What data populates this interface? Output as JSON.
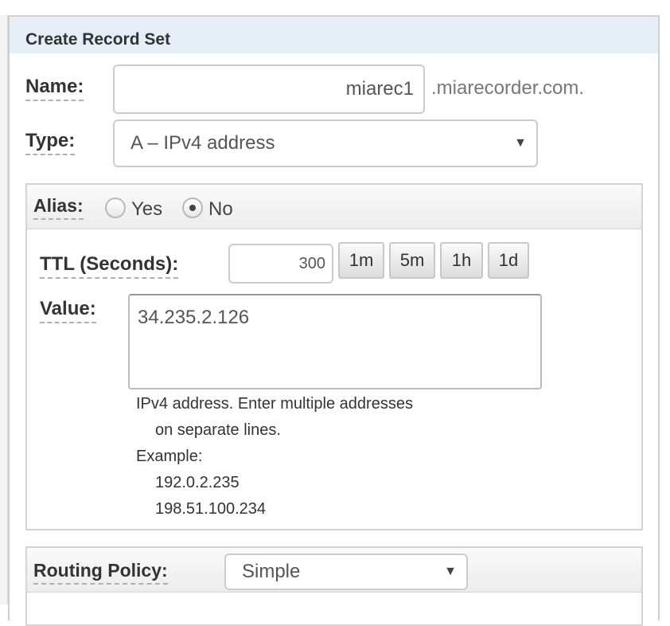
{
  "panel": {
    "title": "Create Record Set"
  },
  "name": {
    "label": "Name:",
    "value": "miarec1",
    "suffix": ".miarecorder.com."
  },
  "type": {
    "label": "Type:",
    "selected": "A – IPv4 address"
  },
  "alias": {
    "label": "Alias:",
    "options": [
      "Yes",
      "No"
    ],
    "selected": "No"
  },
  "ttl": {
    "label": "TTL (Seconds):",
    "value": "300",
    "buttons": [
      "1m",
      "5m",
      "1h",
      "1d"
    ]
  },
  "value": {
    "label": "Value:",
    "text": "34.235.2.126",
    "help": [
      "IPv4 address. Enter multiple addresses",
      "on separate lines.",
      "Example:",
      "192.0.2.235",
      "198.51.100.234"
    ]
  },
  "routing": {
    "label": "Routing Policy:",
    "selected": "Simple"
  },
  "icons": {
    "caret": "chevron-down-icon"
  },
  "colors": {
    "header_bg": "#e6eef8",
    "border": "#cccccc",
    "text": "#333333"
  }
}
